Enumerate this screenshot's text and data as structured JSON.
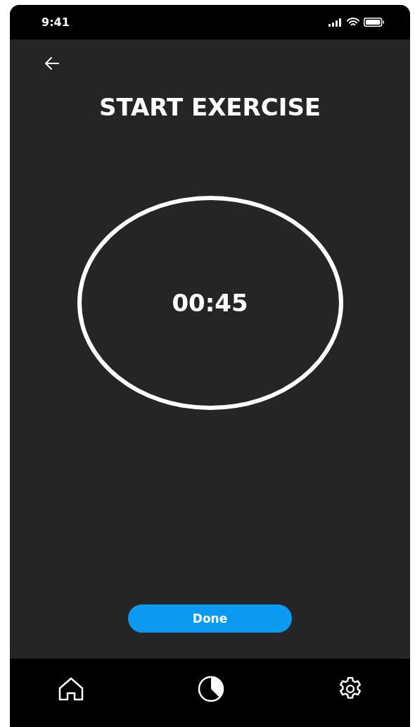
{
  "status_bar": {
    "time": "9:41"
  },
  "title": "START EXERCISE",
  "timer": {
    "time": "00:45"
  },
  "done_button": {
    "label": "Done"
  }
}
